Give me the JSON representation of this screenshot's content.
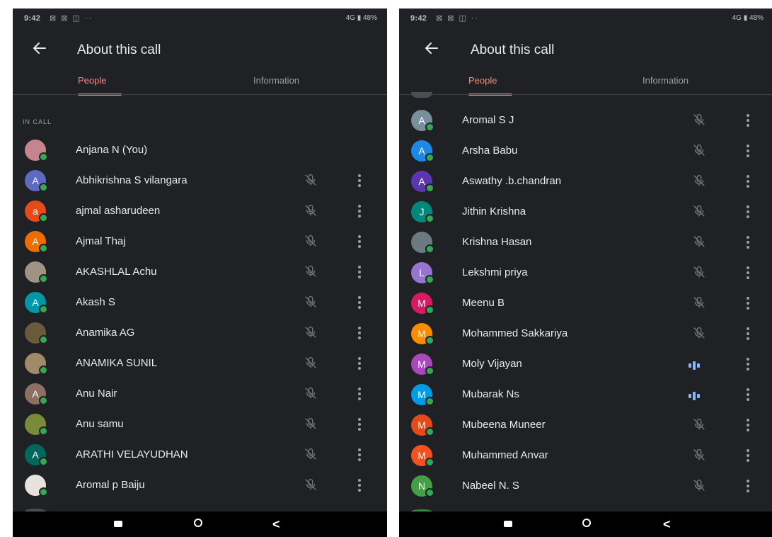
{
  "status_bar": {
    "time": "9:42",
    "notif_icons": "⊠ ⊠ ◫ ··",
    "right": "4G ▮ 48%"
  },
  "app_bar": {
    "title": "About this call"
  },
  "tabs": {
    "people": "People",
    "information": "Information"
  },
  "section": {
    "in_call": "IN CALL"
  },
  "colors": {
    "accent": "#f28b82",
    "background": "#202124",
    "online_dot": "#34a853",
    "speaking": "#8ab4f8"
  },
  "left_list": [
    {
      "name": "Anjana N (You)",
      "initial": "",
      "avatar_color": "#c4868e",
      "mic": "none"
    },
    {
      "name": "Abhikrishna S vilangara",
      "initial": "A",
      "avatar_color": "#5c6bc0",
      "mic": "muted"
    },
    {
      "name": "ajmal asharudeen",
      "initial": "a",
      "avatar_color": "#e64a19",
      "mic": "muted"
    },
    {
      "name": "Ajmal Thaj",
      "initial": "A",
      "avatar_color": "#ef6c00",
      "mic": "muted"
    },
    {
      "name": "AKASHLAL Achu",
      "initial": "",
      "avatar_color": "#9e9484",
      "mic": "muted"
    },
    {
      "name": "Akash S",
      "initial": "A",
      "avatar_color": "#0097a7",
      "mic": "muted"
    },
    {
      "name": "Anamika AG",
      "initial": "",
      "avatar_color": "#6b5b3e",
      "mic": "muted"
    },
    {
      "name": "ANAMIKA SUNIL",
      "initial": "",
      "avatar_color": "#a08a6a",
      "mic": "muted"
    },
    {
      "name": "Anu Nair",
      "initial": "A",
      "avatar_color": "#8d6e63",
      "mic": "muted"
    },
    {
      "name": "Anu samu",
      "initial": "",
      "avatar_color": "#7a8a3a",
      "mic": "muted"
    },
    {
      "name": "ARATHI VELAYUDHAN",
      "initial": "A",
      "avatar_color": "#00695c",
      "mic": "muted"
    },
    {
      "name": "Aromal p Baiju",
      "initial": "",
      "avatar_color": "#e8e2de",
      "mic": "muted"
    }
  ],
  "right_list": [
    {
      "name": "Aromal S J",
      "initial": "A",
      "avatar_color": "#78909c",
      "mic": "muted"
    },
    {
      "name": "Arsha Babu",
      "initial": "A",
      "avatar_color": "#1e88e5",
      "mic": "muted"
    },
    {
      "name": "Aswathy .b.chandran",
      "initial": "A",
      "avatar_color": "#5e35b1",
      "mic": "muted"
    },
    {
      "name": "Jithin Krishna",
      "initial": "J",
      "avatar_color": "#00897b",
      "mic": "muted"
    },
    {
      "name": "Krishna Hasan",
      "initial": "",
      "avatar_color": "#6b7a80",
      "mic": "muted"
    },
    {
      "name": "Lekshmi priya",
      "initial": "L",
      "avatar_color": "#9575cd",
      "mic": "muted"
    },
    {
      "name": "Meenu B",
      "initial": "M",
      "avatar_color": "#d81b60",
      "mic": "muted"
    },
    {
      "name": "Mohammed Sakkariya",
      "initial": "M",
      "avatar_color": "#fb8c00",
      "mic": "muted"
    },
    {
      "name": "Moly Vijayan",
      "initial": "M",
      "avatar_color": "#ab47bc",
      "mic": "speaking"
    },
    {
      "name": "Mubarak Ns",
      "initial": "M",
      "avatar_color": "#039be5",
      "mic": "speaking"
    },
    {
      "name": "Mubeena Muneer",
      "initial": "M",
      "avatar_color": "#e64a19",
      "mic": "muted"
    },
    {
      "name": "Muhammed Anvar",
      "initial": "M",
      "avatar_color": "#f4511e",
      "mic": "muted"
    },
    {
      "name": "Nabeel N. S",
      "initial": "N",
      "avatar_color": "#43a047",
      "mic": "muted"
    }
  ],
  "nav_bar": {
    "recents": "recents-icon",
    "home": "home-icon",
    "back": "back-nav-icon",
    "back_glyph": "<"
  }
}
